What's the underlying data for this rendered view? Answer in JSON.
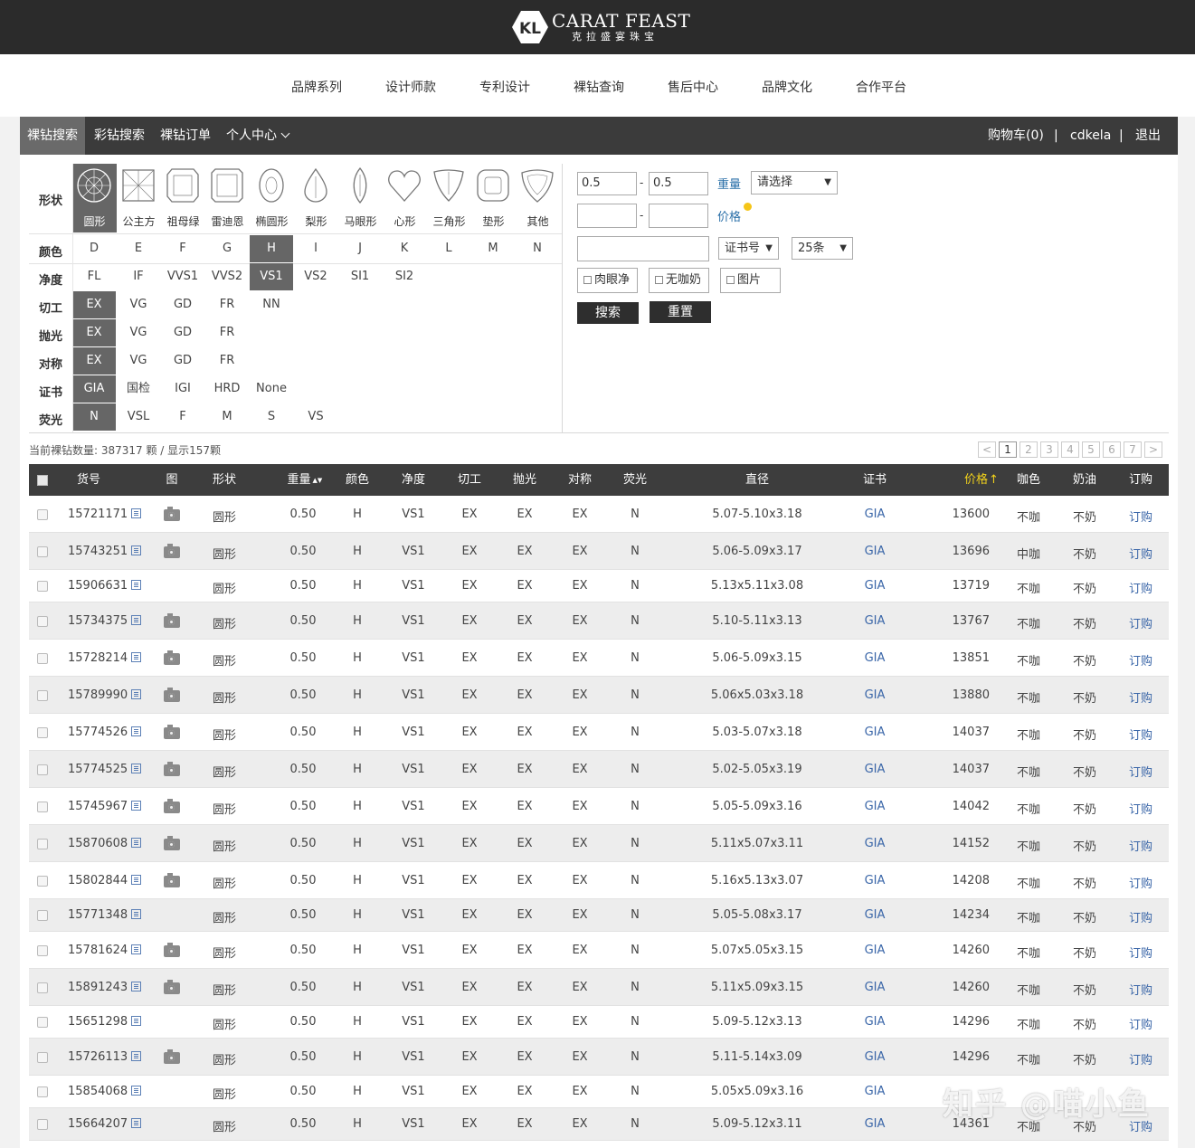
{
  "brand": {
    "en": "CARAT FEAST",
    "cn": "克拉盛宴珠宝",
    "mark": "KL"
  },
  "main_nav": [
    "品牌系列",
    "设计师款",
    "专利设计",
    "裸钻查询",
    "售后中心",
    "品牌文化",
    "合作平台"
  ],
  "sub_nav": {
    "items": [
      "裸钻搜索",
      "彩钻搜索",
      "裸钻订单",
      "个人中心"
    ],
    "active": "裸钻搜索",
    "cart": "购物车(0)",
    "sep": "|",
    "user": "cdkela",
    "logout": "退出"
  },
  "filters": {
    "shape": {
      "label": "形状",
      "options": [
        "圆形",
        "公主方",
        "祖母绿",
        "雷迪恩",
        "椭圆形",
        "梨形",
        "马眼形",
        "心形",
        "三角形",
        "垫形",
        "其他"
      ],
      "selected": "圆形"
    },
    "color": {
      "label": "颜色",
      "options": [
        "D",
        "E",
        "F",
        "G",
        "H",
        "I",
        "J",
        "K",
        "L",
        "M",
        "N"
      ],
      "selected": "H"
    },
    "clarity": {
      "label": "净度",
      "options": [
        "FL",
        "IF",
        "VVS1",
        "VVS2",
        "VS1",
        "VS2",
        "SI1",
        "SI2"
      ],
      "selected": "VS1"
    },
    "cut": {
      "label": "切工",
      "options": [
        "EX",
        "VG",
        "GD",
        "FR",
        "NN"
      ],
      "selected": "EX"
    },
    "polish": {
      "label": "抛光",
      "options": [
        "EX",
        "VG",
        "GD",
        "FR"
      ],
      "selected": "EX"
    },
    "symmetry": {
      "label": "对称",
      "options": [
        "EX",
        "VG",
        "GD",
        "FR"
      ],
      "selected": "EX"
    },
    "cert": {
      "label": "证书",
      "options": [
        "GIA",
        "国检",
        "IGI",
        "HRD",
        "None"
      ],
      "selected": "GIA"
    },
    "fluor": {
      "label": "荧光",
      "options": [
        "N",
        "VSL",
        "F",
        "M",
        "S",
        "VS"
      ],
      "selected": "N"
    }
  },
  "search": {
    "weight_min": "0.5",
    "weight_max": "0.5",
    "dash": "-",
    "weight_label": "重量",
    "weight_select": "请选择",
    "price_min": "",
    "price_max": "",
    "price_label": "价格",
    "cert_input": "",
    "cert_select": "证书号",
    "pagesize_select": "25条",
    "check_eye_clean": "肉眼净",
    "check_no_brown": "无咖奶",
    "check_image": "图片",
    "search_button": "搜索",
    "reset_button": "重置"
  },
  "summary": "当前裸钻数量: 387317 颗 / 显示157颗",
  "pagination": {
    "prev": "<",
    "pages": [
      "1",
      "2",
      "3",
      "4",
      "5",
      "6",
      "7"
    ],
    "current": "1",
    "next": ">"
  },
  "table": {
    "headers": {
      "id": "货号",
      "img": "图",
      "shape": "形状",
      "weight": "重量",
      "color": "颜色",
      "clarity": "净度",
      "cut": "切工",
      "polish": "抛光",
      "symmetry": "对称",
      "fluor": "荧光",
      "dims": "直径",
      "cert": "证书",
      "price": "价格",
      "brown": "咖色",
      "milky": "奶油",
      "order": "订购"
    },
    "sort_arrow_both": "▲▼",
    "sort_arrow_up": "↑",
    "rows": [
      {
        "id": "15721171",
        "img": true,
        "shape": "圆形",
        "weight": "0.50",
        "color": "H",
        "clarity": "VS1",
        "cut": "EX",
        "polish": "EX",
        "sym": "EX",
        "fluor": "N",
        "dims": "5.07-5.10x3.18",
        "cert": "GIA",
        "price": "13600",
        "brown": "不咖",
        "milky": "不奶",
        "order": "订购"
      },
      {
        "id": "15743251",
        "img": true,
        "shape": "圆形",
        "weight": "0.50",
        "color": "H",
        "clarity": "VS1",
        "cut": "EX",
        "polish": "EX",
        "sym": "EX",
        "fluor": "N",
        "dims": "5.06-5.09x3.17",
        "cert": "GIA",
        "price": "13696",
        "brown": "中咖",
        "milky": "不奶",
        "order": "订购"
      },
      {
        "id": "15906631",
        "img": false,
        "shape": "圆形",
        "weight": "0.50",
        "color": "H",
        "clarity": "VS1",
        "cut": "EX",
        "polish": "EX",
        "sym": "EX",
        "fluor": "N",
        "dims": "5.13x5.11x3.08",
        "cert": "GIA",
        "price": "13719",
        "brown": "不咖",
        "milky": "不奶",
        "order": "订购"
      },
      {
        "id": "15734375",
        "img": true,
        "shape": "圆形",
        "weight": "0.50",
        "color": "H",
        "clarity": "VS1",
        "cut": "EX",
        "polish": "EX",
        "sym": "EX",
        "fluor": "N",
        "dims": "5.10-5.11x3.13",
        "cert": "GIA",
        "price": "13767",
        "brown": "不咖",
        "milky": "不奶",
        "order": "订购"
      },
      {
        "id": "15728214",
        "img": true,
        "shape": "圆形",
        "weight": "0.50",
        "color": "H",
        "clarity": "VS1",
        "cut": "EX",
        "polish": "EX",
        "sym": "EX",
        "fluor": "N",
        "dims": "5.06-5.09x3.15",
        "cert": "GIA",
        "price": "13851",
        "brown": "不咖",
        "milky": "不奶",
        "order": "订购"
      },
      {
        "id": "15789990",
        "img": true,
        "shape": "圆形",
        "weight": "0.50",
        "color": "H",
        "clarity": "VS1",
        "cut": "EX",
        "polish": "EX",
        "sym": "EX",
        "fluor": "N",
        "dims": "5.06x5.03x3.18",
        "cert": "GIA",
        "price": "13880",
        "brown": "不咖",
        "milky": "不奶",
        "order": "订购"
      },
      {
        "id": "15774526",
        "img": true,
        "shape": "圆形",
        "weight": "0.50",
        "color": "H",
        "clarity": "VS1",
        "cut": "EX",
        "polish": "EX",
        "sym": "EX",
        "fluor": "N",
        "dims": "5.03-5.07x3.18",
        "cert": "GIA",
        "price": "14037",
        "brown": "不咖",
        "milky": "不奶",
        "order": "订购"
      },
      {
        "id": "15774525",
        "img": true,
        "shape": "圆形",
        "weight": "0.50",
        "color": "H",
        "clarity": "VS1",
        "cut": "EX",
        "polish": "EX",
        "sym": "EX",
        "fluor": "N",
        "dims": "5.02-5.05x3.19",
        "cert": "GIA",
        "price": "14037",
        "brown": "不咖",
        "milky": "不奶",
        "order": "订购"
      },
      {
        "id": "15745967",
        "img": true,
        "shape": "圆形",
        "weight": "0.50",
        "color": "H",
        "clarity": "VS1",
        "cut": "EX",
        "polish": "EX",
        "sym": "EX",
        "fluor": "N",
        "dims": "5.05-5.09x3.16",
        "cert": "GIA",
        "price": "14042",
        "brown": "不咖",
        "milky": "不奶",
        "order": "订购"
      },
      {
        "id": "15870608",
        "img": true,
        "shape": "圆形",
        "weight": "0.50",
        "color": "H",
        "clarity": "VS1",
        "cut": "EX",
        "polish": "EX",
        "sym": "EX",
        "fluor": "N",
        "dims": "5.11x5.07x3.11",
        "cert": "GIA",
        "price": "14152",
        "brown": "不咖",
        "milky": "不奶",
        "order": "订购"
      },
      {
        "id": "15802844",
        "img": true,
        "shape": "圆形",
        "weight": "0.50",
        "color": "H",
        "clarity": "VS1",
        "cut": "EX",
        "polish": "EX",
        "sym": "EX",
        "fluor": "N",
        "dims": "5.16x5.13x3.07",
        "cert": "GIA",
        "price": "14208",
        "brown": "不咖",
        "milky": "不奶",
        "order": "订购"
      },
      {
        "id": "15771348",
        "img": false,
        "shape": "圆形",
        "weight": "0.50",
        "color": "H",
        "clarity": "VS1",
        "cut": "EX",
        "polish": "EX",
        "sym": "EX",
        "fluor": "N",
        "dims": "5.05-5.08x3.17",
        "cert": "GIA",
        "price": "14234",
        "brown": "不咖",
        "milky": "不奶",
        "order": "订购"
      },
      {
        "id": "15781624",
        "img": true,
        "shape": "圆形",
        "weight": "0.50",
        "color": "H",
        "clarity": "VS1",
        "cut": "EX",
        "polish": "EX",
        "sym": "EX",
        "fluor": "N",
        "dims": "5.07x5.05x3.15",
        "cert": "GIA",
        "price": "14260",
        "brown": "不咖",
        "milky": "不奶",
        "order": "订购"
      },
      {
        "id": "15891243",
        "img": true,
        "shape": "圆形",
        "weight": "0.50",
        "color": "H",
        "clarity": "VS1",
        "cut": "EX",
        "polish": "EX",
        "sym": "EX",
        "fluor": "N",
        "dims": "5.11x5.09x3.15",
        "cert": "GIA",
        "price": "14260",
        "brown": "不咖",
        "milky": "不奶",
        "order": "订购"
      },
      {
        "id": "15651298",
        "img": false,
        "shape": "圆形",
        "weight": "0.50",
        "color": "H",
        "clarity": "VS1",
        "cut": "EX",
        "polish": "EX",
        "sym": "EX",
        "fluor": "N",
        "dims": "5.09-5.12x3.13",
        "cert": "GIA",
        "price": "14296",
        "brown": "不咖",
        "milky": "不奶",
        "order": "订购"
      },
      {
        "id": "15726113",
        "img": true,
        "shape": "圆形",
        "weight": "0.50",
        "color": "H",
        "clarity": "VS1",
        "cut": "EX",
        "polish": "EX",
        "sym": "EX",
        "fluor": "N",
        "dims": "5.11-5.14x3.09",
        "cert": "GIA",
        "price": "14296",
        "brown": "不咖",
        "milky": "不奶",
        "order": "订购"
      },
      {
        "id": "15854068",
        "img": false,
        "shape": "圆形",
        "weight": "0.50",
        "color": "H",
        "clarity": "VS1",
        "cut": "EX",
        "polish": "EX",
        "sym": "EX",
        "fluor": "N",
        "dims": "5.05x5.09x3.16",
        "cert": "GIA",
        "price": "",
        "brown": "",
        "milky": "",
        "order": ""
      },
      {
        "id": "15664207",
        "img": false,
        "shape": "圆形",
        "weight": "0.50",
        "color": "H",
        "clarity": "VS1",
        "cut": "EX",
        "polish": "EX",
        "sym": "EX",
        "fluor": "N",
        "dims": "5.09-5.12x3.11",
        "cert": "GIA",
        "price": "14361",
        "brown": "不咖",
        "milky": "不奶",
        "order": "订购"
      }
    ]
  },
  "watermark": "知乎 @喵小鱼",
  "colors": {
    "topbar": "#2b2b2b",
    "subnav": "#3b3b3b",
    "selected": "#666666",
    "link": "#3a66a8",
    "price_header": "#f2d21b",
    "weight_label": "#2a6fa8"
  }
}
